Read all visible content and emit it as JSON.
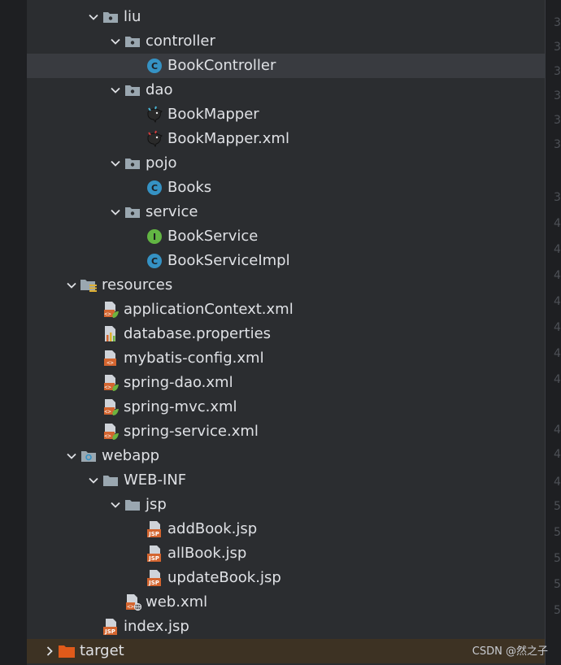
{
  "tree": {
    "items": [
      {
        "label": "liu",
        "icon": "package-folder-icon",
        "expanded": true
      },
      {
        "label": "controller",
        "icon": "package-folder-icon",
        "expanded": true
      },
      {
        "label": "BookController",
        "icon": "java-class-icon",
        "selected": true
      },
      {
        "label": "dao",
        "icon": "package-folder-icon",
        "expanded": true
      },
      {
        "label": "BookMapper",
        "icon": "mybatis-mapper-icon"
      },
      {
        "label": "BookMapper.xml",
        "icon": "mybatis-xml-icon"
      },
      {
        "label": "pojo",
        "icon": "package-folder-icon",
        "expanded": true
      },
      {
        "label": "Books",
        "icon": "java-class-icon"
      },
      {
        "label": "service",
        "icon": "package-folder-icon",
        "expanded": true
      },
      {
        "label": "BookService",
        "icon": "java-interface-icon"
      },
      {
        "label": "BookServiceImpl",
        "icon": "java-class-icon"
      },
      {
        "label": "resources",
        "icon": "resources-folder-icon",
        "expanded": true
      },
      {
        "label": "applicationContext.xml",
        "icon": "spring-xml-icon"
      },
      {
        "label": "database.properties",
        "icon": "properties-file-icon"
      },
      {
        "label": "mybatis-config.xml",
        "icon": "xml-file-icon"
      },
      {
        "label": "spring-dao.xml",
        "icon": "spring-xml-icon"
      },
      {
        "label": "spring-mvc.xml",
        "icon": "spring-xml-icon"
      },
      {
        "label": "spring-service.xml",
        "icon": "spring-xml-icon"
      },
      {
        "label": "webapp",
        "icon": "web-folder-icon",
        "expanded": true
      },
      {
        "label": "WEB-INF",
        "icon": "folder-icon",
        "expanded": true
      },
      {
        "label": "jsp",
        "icon": "folder-icon",
        "expanded": true
      },
      {
        "label": "addBook.jsp",
        "icon": "jsp-file-icon"
      },
      {
        "label": "allBook.jsp",
        "icon": "jsp-file-icon"
      },
      {
        "label": "updateBook.jsp",
        "icon": "jsp-file-icon"
      },
      {
        "label": "web.xml",
        "icon": "web-xml-icon"
      },
      {
        "label": "index.jsp",
        "icon": "jsp-file-icon"
      },
      {
        "label": "target",
        "icon": "excluded-folder-icon",
        "expanded": false
      }
    ]
  },
  "gutter": {
    "numbers": [
      "3",
      "3",
      "3",
      "3",
      "3",
      "3",
      "3",
      "4",
      "4",
      "4",
      "4",
      "4",
      "4",
      "4",
      "4",
      "4",
      "4",
      "5",
      "5",
      "5",
      "5",
      "5"
    ]
  },
  "watermark": "CSDN @然之子",
  "colors": {
    "panel_bg": "#2b2d30",
    "selected_row": "#393b40",
    "target_row": "#3d3223",
    "java_class": "#3592c4",
    "java_interface": "#62b543",
    "folder_gray": "#9aa7b0",
    "jsp_orange": "#d4652f",
    "spring_green": "#6db33f",
    "target_folder": "#e05a1a"
  }
}
